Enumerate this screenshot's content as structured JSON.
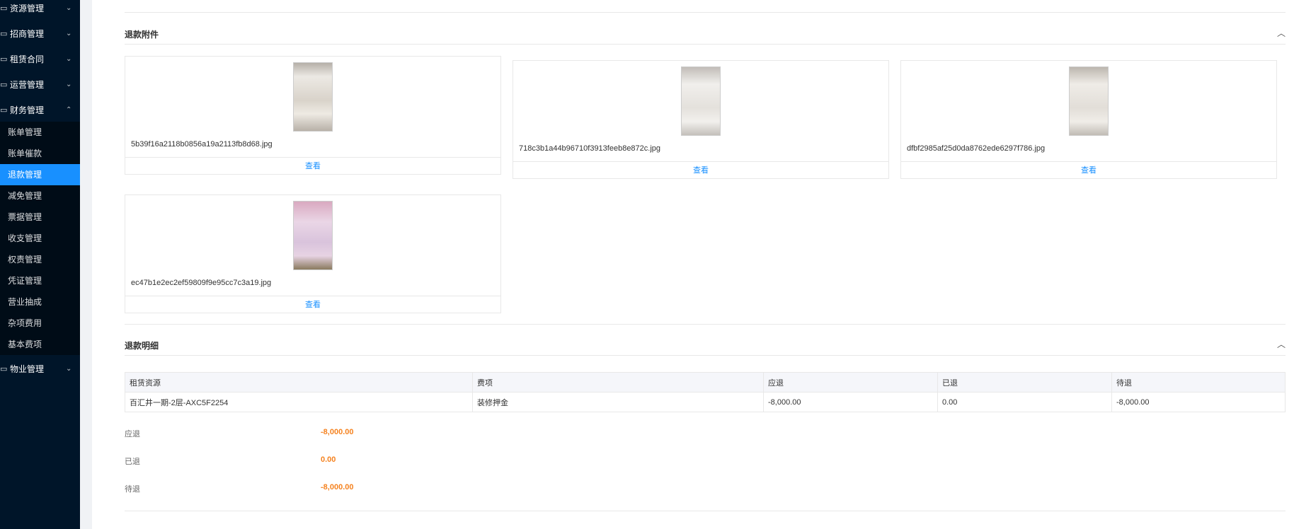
{
  "sidebar": {
    "groups_top": [
      {
        "label": "资源管理",
        "icon": "folder-icon"
      },
      {
        "label": "招商管理",
        "icon": "folder-icon"
      },
      {
        "label": "租赁合同",
        "icon": "folder-icon"
      },
      {
        "label": "运营管理",
        "icon": "folder-icon"
      },
      {
        "label": "财务管理",
        "icon": "folder-icon"
      }
    ],
    "finance_items": [
      "账单管理",
      "账单催款",
      "退款管理",
      "减免管理",
      "票据管理",
      "收支管理",
      "权责管理",
      "凭证管理",
      "营业抽成",
      "杂项费用",
      "基本费项"
    ],
    "active_item": "退款管理",
    "group_bottom": {
      "label": "物业管理",
      "icon": "folder-icon"
    }
  },
  "attachments_section": {
    "title": "退款附件",
    "view_label": "查看",
    "files": [
      {
        "name": "5b39f16a2118b0856a19a2113fb8d68.jpg"
      },
      {
        "name": "718c3b1a44b96710f3913feeb8e872c.jpg"
      },
      {
        "name": "dfbf2985af25d0da8762ede6297f786.jpg"
      },
      {
        "name": "ec47b1e2ec2ef59809f9e95cc7c3a19.jpg"
      }
    ]
  },
  "detail_section": {
    "title": "退款明细",
    "columns": [
      "租赁资源",
      "费项",
      "应退",
      "已退",
      "待退"
    ],
    "rows": [
      [
        "百汇井一期-2层-AXC5F2254",
        "装修押金",
        "-8,000.00",
        "0.00",
        "-8,000.00"
      ]
    ],
    "summary": [
      {
        "label": "应退",
        "value": "-8,000.00"
      },
      {
        "label": "已退",
        "value": "0.00"
      },
      {
        "label": "待退",
        "value": "-8,000.00"
      }
    ]
  },
  "colors": {
    "sidebar_bg": "#001529",
    "active": "#1890ff",
    "accent_orange": "#f5821f"
  }
}
